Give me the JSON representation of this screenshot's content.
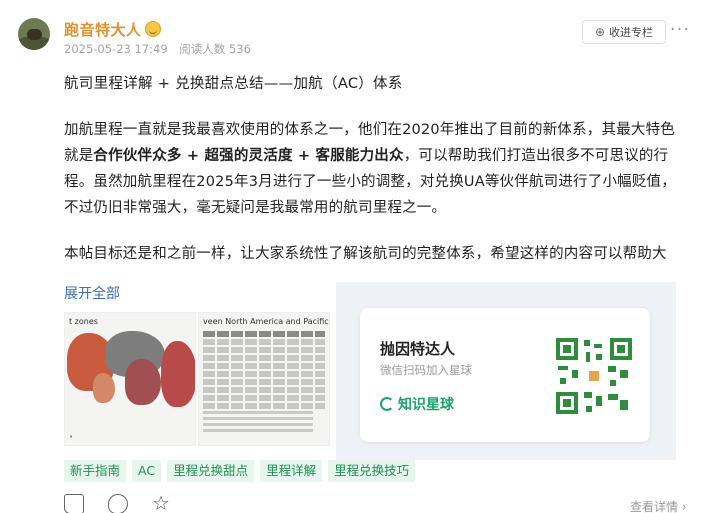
{
  "author": {
    "name": "跑音特大人",
    "publish_time": "2025-05-23 17:49",
    "read_count": "阅读人数 536"
  },
  "header_actions": {
    "favorite_label": "收进专栏",
    "more_label": "···"
  },
  "post": {
    "title": "航司里程详解 + 兑换甜点总结——加航（AC）体系",
    "p1_a": "加航里程一直就是我最喜欢使用的体系之一，他们在2020年推出了目前的新体系，其最大特色就是",
    "p1_bold": "合作伙伴众多 + 超强的灵活度 + 客服能力出众",
    "p1_b": "，可以帮助我们打造出很多不可思议的行程。虽然加航里程在2025年3月进行了一些小的调整，对兑换UA等伙伴航司进行了小幅贬值，不过仍旧非常强大，毫无疑问是我最常用的航司里程之一。",
    "p2": "本帖目标还是和之前一样，让大家系统性了解该航司的完整体系，希望这样的内容可以帮助大",
    "expand_label": "展开全部"
  },
  "images": {
    "img1_caption": "t zones",
    "img1_foot": "•",
    "img2_caption": "veen North America and Pacific zones"
  },
  "promo": {
    "name": "抛因特达人",
    "subtitle": "微信扫码加入星球",
    "brand": "知识星球"
  },
  "tags": [
    "新手指南",
    "AC",
    "里程兑换甜点",
    "里程详解",
    "里程兑换技巧"
  ],
  "footer": {
    "view_detail": "查看详情 ›"
  },
  "colors": {
    "author_name": "#e0922e",
    "link": "#3b6fb5",
    "tag_text": "#1f8f55",
    "tag_bg": "#e7f6ec",
    "brand_green": "#1aa36b"
  }
}
